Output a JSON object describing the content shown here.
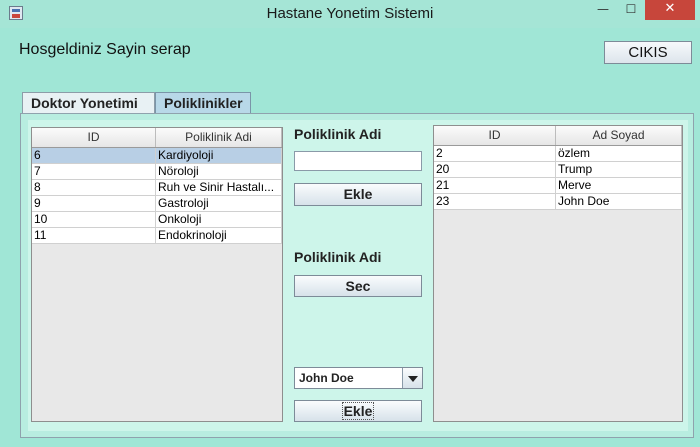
{
  "window": {
    "title": "Hastane Yonetim Sistemi",
    "minimize_label": "—",
    "maximize_label": "☐",
    "close_label": "✕"
  },
  "header": {
    "welcome": "Hosgeldiniz Sayin serap",
    "logout_label": "CIKIS"
  },
  "tabs": [
    {
      "label": "Doktor Yonetimi",
      "active": false
    },
    {
      "label": "Poliklinikler",
      "active": true
    }
  ],
  "poliklinik_table": {
    "columns": [
      "ID",
      "Poliklinik Adi"
    ],
    "rows": [
      {
        "id": "6",
        "name": "Kardiyoloji",
        "selected": true
      },
      {
        "id": "7",
        "name": "Nöroloji",
        "selected": false
      },
      {
        "id": "8",
        "name": "Ruh ve Sinir Hastalı...",
        "selected": false
      },
      {
        "id": "9",
        "name": "Gastroloji",
        "selected": false
      },
      {
        "id": "10",
        "name": "Onkoloji",
        "selected": false
      },
      {
        "id": "11",
        "name": "Endokrinoloji",
        "selected": false
      }
    ]
  },
  "form": {
    "add_label": "Poliklinik Adi",
    "add_input_value": "",
    "add_button": "Ekle",
    "select_label": "Poliklinik Adi",
    "select_button": "Sec",
    "doctor_dropdown_value": "John Doe",
    "assign_button": "Ekle"
  },
  "doctor_table": {
    "columns": [
      "ID",
      "Ad Soyad"
    ],
    "rows": [
      {
        "id": "2",
        "name": "özlem"
      },
      {
        "id": "20",
        "name": "Trump"
      },
      {
        "id": "21",
        "name": "Merve"
      },
      {
        "id": "23",
        "name": "John Doe"
      }
    ]
  },
  "colors": {
    "background": "#a0e6d6",
    "selected_row": "#b8cfe5",
    "close_button": "#c7463b"
  }
}
